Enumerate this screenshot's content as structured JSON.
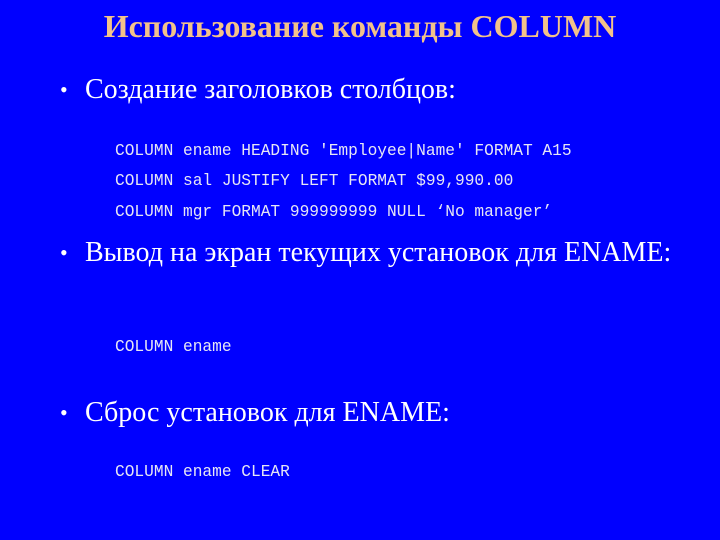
{
  "slide": {
    "title": "Использование команды COLUMN",
    "colors": {
      "background": "#0000FF",
      "title": "#F2C28A",
      "text": "#FFFFFF",
      "code": "#E6E6F5"
    },
    "bullet_glyph": "•",
    "sections": [
      {
        "bullet": "Создание заголовков столбцов:",
        "code": [
          "COLUMN ename HEADING 'Employee|Name' FORMAT A15",
          "COLUMN sal JUSTIFY LEFT FORMAT $99,990.00",
          "COLUMN mgr FORMAT 999999999 NULL ‘No manager’"
        ]
      },
      {
        "bullet": "Вывод на экран текущих установок для ENAME:",
        "code": [
          "COLUMN ename"
        ]
      },
      {
        "bullet": "Сброс установок для ENAME:",
        "code": [
          "COLUMN ename CLEAR"
        ]
      }
    ]
  }
}
